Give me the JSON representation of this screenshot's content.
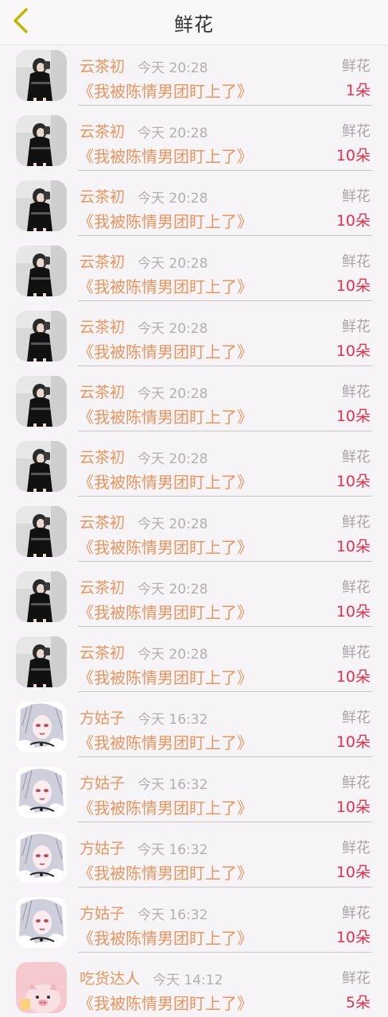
{
  "header": {
    "title": "鲜花",
    "back_icon": "chevron-left-icon",
    "back_color": "#c2b400"
  },
  "avatars": {
    "girl-black-dress": {
      "bg": "#d9d9d9",
      "dress": "#111111"
    },
    "anime-white-hair": {
      "bg": "#ffffff",
      "hair": "#cfcfdc"
    },
    "pink-pig": {
      "bg": "#f6c9cf",
      "face": "#f9e0e3"
    }
  },
  "records": [
    {
      "avatar": "girl-black-dress",
      "name": "云茶初",
      "time": "今天 20:28",
      "label": "鲜花",
      "book": "《我被陈情男团盯上了》",
      "count": "1朵"
    },
    {
      "avatar": "girl-black-dress",
      "name": "云茶初",
      "time": "今天 20:28",
      "label": "鲜花",
      "book": "《我被陈情男团盯上了》",
      "count": "10朵"
    },
    {
      "avatar": "girl-black-dress",
      "name": "云茶初",
      "time": "今天 20:28",
      "label": "鲜花",
      "book": "《我被陈情男团盯上了》",
      "count": "10朵"
    },
    {
      "avatar": "girl-black-dress",
      "name": "云茶初",
      "time": "今天 20:28",
      "label": "鲜花",
      "book": "《我被陈情男团盯上了》",
      "count": "10朵"
    },
    {
      "avatar": "girl-black-dress",
      "name": "云茶初",
      "time": "今天 20:28",
      "label": "鲜花",
      "book": "《我被陈情男团盯上了》",
      "count": "10朵"
    },
    {
      "avatar": "girl-black-dress",
      "name": "云茶初",
      "time": "今天 20:28",
      "label": "鲜花",
      "book": "《我被陈情男团盯上了》",
      "count": "10朵"
    },
    {
      "avatar": "girl-black-dress",
      "name": "云茶初",
      "time": "今天 20:28",
      "label": "鲜花",
      "book": "《我被陈情男团盯上了》",
      "count": "10朵"
    },
    {
      "avatar": "girl-black-dress",
      "name": "云茶初",
      "time": "今天 20:28",
      "label": "鲜花",
      "book": "《我被陈情男团盯上了》",
      "count": "10朵"
    },
    {
      "avatar": "girl-black-dress",
      "name": "云茶初",
      "time": "今天 20:28",
      "label": "鲜花",
      "book": "《我被陈情男团盯上了》",
      "count": "10朵"
    },
    {
      "avatar": "girl-black-dress",
      "name": "云茶初",
      "time": "今天 20:28",
      "label": "鲜花",
      "book": "《我被陈情男团盯上了》",
      "count": "10朵"
    },
    {
      "avatar": "anime-white-hair",
      "name": "方姑子",
      "time": "今天 16:32",
      "label": "鲜花",
      "book": "《我被陈情男团盯上了》",
      "count": "10朵"
    },
    {
      "avatar": "anime-white-hair",
      "name": "方姑子",
      "time": "今天 16:32",
      "label": "鲜花",
      "book": "《我被陈情男团盯上了》",
      "count": "10朵"
    },
    {
      "avatar": "anime-white-hair",
      "name": "方姑子",
      "time": "今天 16:32",
      "label": "鲜花",
      "book": "《我被陈情男团盯上了》",
      "count": "10朵"
    },
    {
      "avatar": "anime-white-hair",
      "name": "方姑子",
      "time": "今天 16:32",
      "label": "鲜花",
      "book": "《我被陈情男团盯上了》",
      "count": "10朵"
    },
    {
      "avatar": "pink-pig",
      "name": "吃货达人",
      "time": "今天 14:12",
      "label": "鲜花",
      "book": "《我被陈情男团盯上了》",
      "count": "5朵"
    }
  ]
}
